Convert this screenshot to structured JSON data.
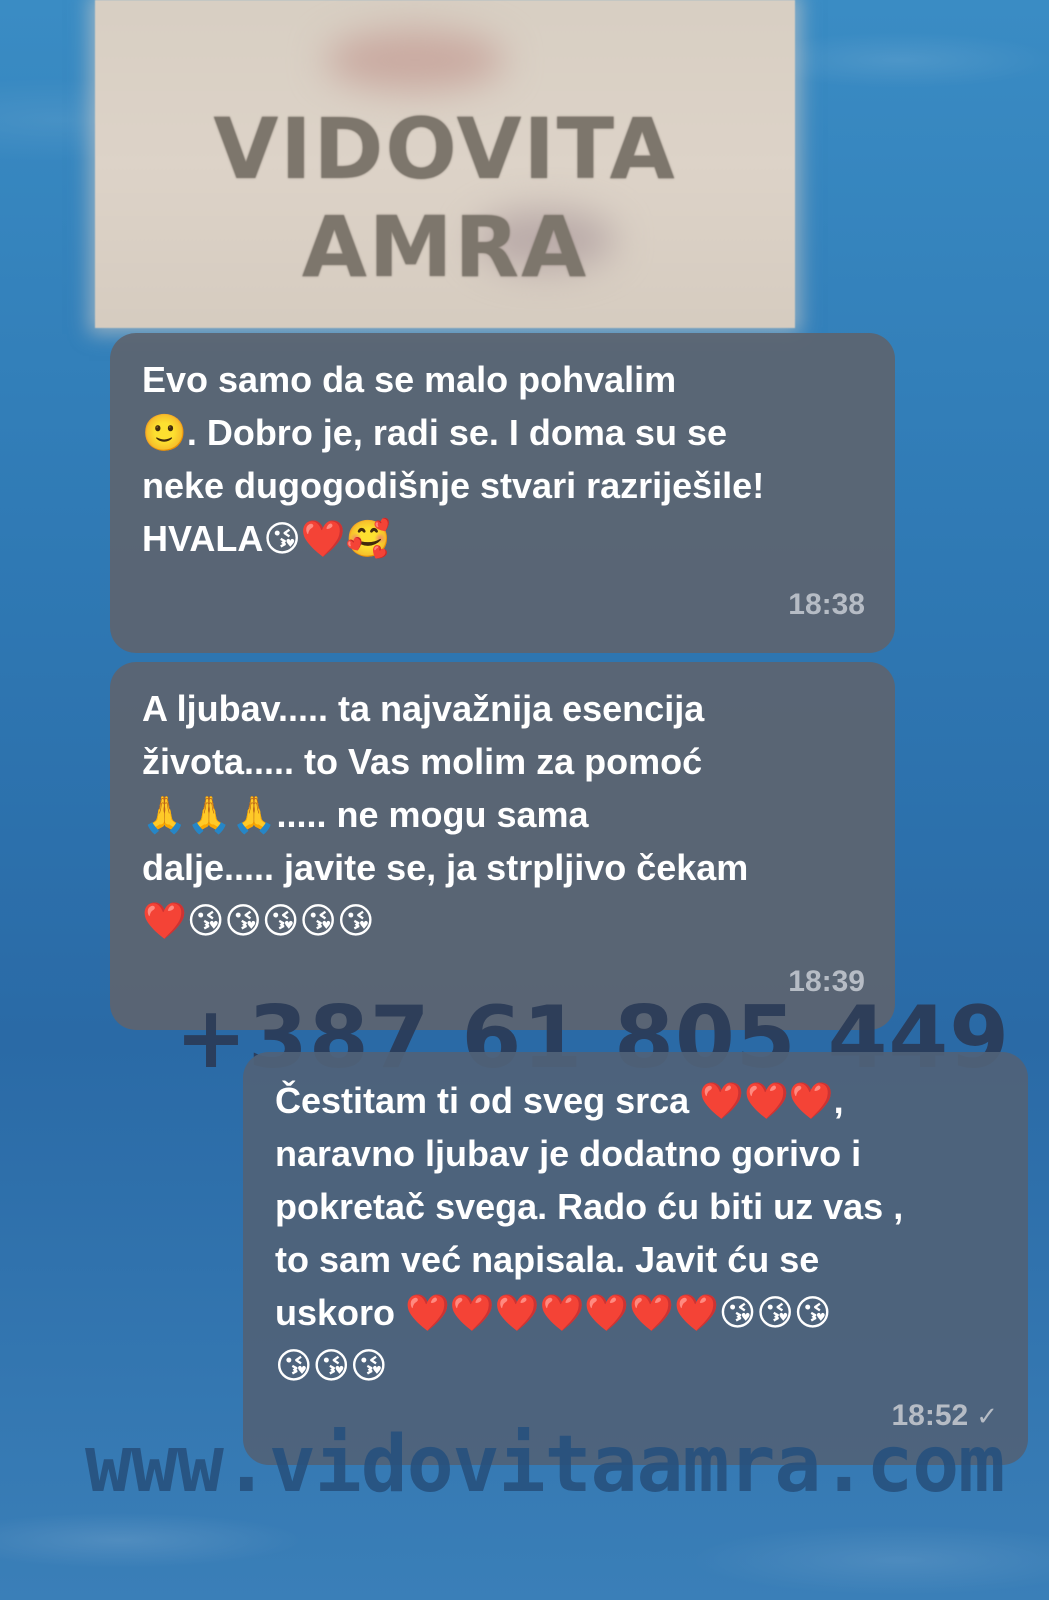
{
  "media": {
    "title": "VIDOVITA AMRA"
  },
  "messages": [
    {
      "direction": "incoming",
      "text": "Evo samo da se malo pohvalim\n🙂. Dobro je, radi se. I doma su se\nneke dugogodišnje stvari razriješile!\nHVALA😘❤️🥰",
      "time": "18:38"
    },
    {
      "direction": "incoming",
      "text": "A ljubav..... ta najvažnija esencija\nživota..... to Vas molim za pomoć\n🙏🙏🙏..... ne mogu sama\ndalje..... javite se, ja strpljivo čekam\n❤️😘😘😘😘😘",
      "time": "18:39"
    },
    {
      "direction": "outgoing",
      "text": "Čestitam ti od sveg srca ❤️❤️❤️,\nnaravno ljubav je dodatno gorivo i\npokretač svega. Rado ću biti uz vas ,\nto sam već napisala. Javit ću se\nuskoro ❤️❤️❤️❤️❤️❤️❤️😘😘😘\n😘😘😘",
      "time": "18:52",
      "status_icon": "single-check-icon"
    }
  ],
  "watermarks": {
    "phone": "+387 61 805 449",
    "url": "www.vidovitaamra.com"
  }
}
